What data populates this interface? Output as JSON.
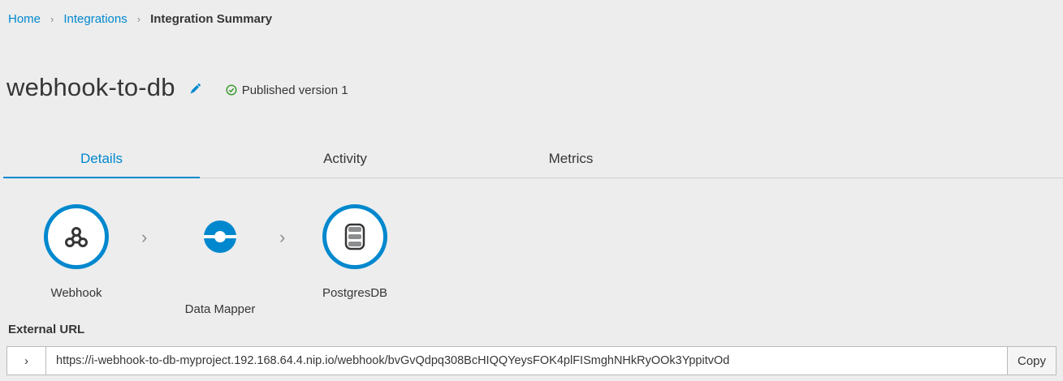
{
  "breadcrumb": {
    "home": "Home",
    "separator": "›",
    "integrations": "Integrations",
    "current": "Integration Summary"
  },
  "integration": {
    "name": "webhook-to-db",
    "status": "Published version 1"
  },
  "tabs": [
    {
      "label": "Details",
      "active": true
    },
    {
      "label": "Activity",
      "active": false
    },
    {
      "label": "Metrics",
      "active": false
    }
  ],
  "steps": [
    {
      "label": "Webhook",
      "icon": "webhook-icon"
    },
    {
      "label": "Data Mapper",
      "icon": "data-mapper-icon"
    },
    {
      "label": "PostgresDB",
      "icon": "database-icon"
    }
  ],
  "step_separator": "›",
  "external_url": {
    "label": "External URL",
    "toggle": "›",
    "value": "https://i-webhook-to-db-myproject.192.168.64.4.nip.io/webhook/bvGvQdpq308BcHIQQYeysFOK4plFISmghNHkRyOOk3YppitvOd",
    "copy_label": "Copy"
  },
  "colors": {
    "accent": "#0088ce",
    "success": "#3f9c35",
    "background": "#ededed"
  }
}
